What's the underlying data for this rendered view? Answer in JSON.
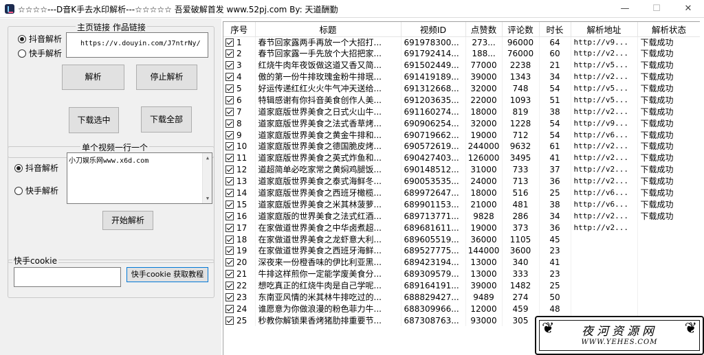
{
  "window": {
    "title": "☆☆☆☆---D音K手去水印解析---☆☆☆☆☆  吾爱破解首发   www.52pj.com   By:  天道酬勤",
    "min_glyph": "—",
    "max_glyph": "☐",
    "close_glyph": "✕"
  },
  "link_group": {
    "title": "主页链接  作品链接",
    "radio_douyin": "抖音解析",
    "radio_kuaishou": "快手解析",
    "url_value": "https://v.douyin.com/J7ntrNy/",
    "btn_parse": "解析",
    "btn_stop": "停止解析",
    "btn_download_selected": "下载选中",
    "btn_download_all": "下载全部"
  },
  "single_group": {
    "title": "单个视频一行一个",
    "radio_douyin": "抖音解析",
    "radio_kuaishou": "快手解析",
    "textarea_value": "小刀娱乐网www.x6d.com",
    "btn_start": "开始解析"
  },
  "cookie_group": {
    "title": "快手cookie",
    "input_value": "",
    "btn_tutorial": "快手cookie 获取教程"
  },
  "table": {
    "columns": [
      "序号",
      "标题",
      "视频ID",
      "点赞数",
      "评论数",
      "时长",
      "解析地址",
      "解析状态"
    ],
    "rows": [
      {
        "idx": "1",
        "title": "春节回家露两手再放一个大招打...",
        "vid": "691978300...",
        "likes": "273...",
        "comments": "96000",
        "dur": "64",
        "url": "http://v9...",
        "status": "下载成功"
      },
      {
        "idx": "2",
        "title": "春节回家露一手先放个大招把家...",
        "vid": "691792414...",
        "likes": "188...",
        "comments": "76000",
        "dur": "60",
        "url": "http://v2...",
        "status": "下载成功"
      },
      {
        "idx": "3",
        "title": "红烧牛肉年夜饭做这道又香又简...",
        "vid": "691502449...",
        "likes": "77000",
        "comments": "2238",
        "dur": "21",
        "url": "http://v5...",
        "status": "下载成功"
      },
      {
        "idx": "4",
        "title": "傲的第一份牛排玫瑰金粉牛排珉...",
        "vid": "691419189...",
        "likes": "39000",
        "comments": "1343",
        "dur": "34",
        "url": "http://v2...",
        "status": "下载成功"
      },
      {
        "idx": "5",
        "title": "好运传递红红火火牛气冲天送给...",
        "vid": "691312668...",
        "likes": "32000",
        "comments": "748",
        "dur": "54",
        "url": "http://v5...",
        "status": "下载成功"
      },
      {
        "idx": "6",
        "title": "特辑感谢有你抖音美食创作人美...",
        "vid": "691203635...",
        "likes": "22000",
        "comments": "1093",
        "dur": "51",
        "url": "http://v5...",
        "status": "下载成功"
      },
      {
        "idx": "7",
        "title": "道家庭版世界美食之日式火山牛...",
        "vid": "691160274...",
        "likes": "18000",
        "comments": "819",
        "dur": "38",
        "url": "http://v2...",
        "status": "下载成功"
      },
      {
        "idx": "8",
        "title": "道家庭版世界美食之法式香草烤...",
        "vid": "690906254...",
        "likes": "32000",
        "comments": "1228",
        "dur": "54",
        "url": "http://v9...",
        "status": "下载成功"
      },
      {
        "idx": "9",
        "title": "道家庭版世界美食之黄金牛排和...",
        "vid": "690719662...",
        "likes": "19000",
        "comments": "712",
        "dur": "54",
        "url": "http://v6...",
        "status": "下载成功"
      },
      {
        "idx": "10",
        "title": "道家庭版世界美食之德国脆皮烤...",
        "vid": "690572619...",
        "likes": "244000",
        "comments": "9632",
        "dur": "61",
        "url": "http://v2...",
        "status": "下载成功"
      },
      {
        "idx": "11",
        "title": "道家庭版世界美食之英式炸鱼和...",
        "vid": "690427403...",
        "likes": "126000",
        "comments": "3495",
        "dur": "41",
        "url": "http://v2...",
        "status": "下载成功"
      },
      {
        "idx": "12",
        "title": "道超简单必吃家常之黄焖鸡腿饭...",
        "vid": "690148512...",
        "likes": "31000",
        "comments": "733",
        "dur": "37",
        "url": "http://v2...",
        "status": "下载成功"
      },
      {
        "idx": "13",
        "title": "道家庭版世界美食之泰式海鲜冬...",
        "vid": "690053535...",
        "likes": "24000",
        "comments": "713",
        "dur": "36",
        "url": "http://v2...",
        "status": "下载成功"
      },
      {
        "idx": "14",
        "title": "道家庭版世界美食之西班牙橄榄...",
        "vid": "689972647...",
        "likes": "18000",
        "comments": "516",
        "dur": "25",
        "url": "http://v6...",
        "status": "下载成功"
      },
      {
        "idx": "15",
        "title": "道家庭版世界美食之米其林菠萝...",
        "vid": "689901153...",
        "likes": "21000",
        "comments": "481",
        "dur": "38",
        "url": "http://v6...",
        "status": "下载成功"
      },
      {
        "idx": "16",
        "title": "道家庭版的世界美食之法式红酒...",
        "vid": "689713771...",
        "likes": "9828",
        "comments": "286",
        "dur": "34",
        "url": "http://v2...",
        "status": "下载成功"
      },
      {
        "idx": "17",
        "title": "在家做道世界美食之中华卤煮超...",
        "vid": "689681611...",
        "likes": "19000",
        "comments": "373",
        "dur": "36",
        "url": "http://v2...",
        "status": ""
      },
      {
        "idx": "18",
        "title": "在家做道世界美食之龙虾意大利...",
        "vid": "689605519...",
        "likes": "36000",
        "comments": "1105",
        "dur": "45",
        "url": "",
        "status": ""
      },
      {
        "idx": "19",
        "title": "在家做道世界美食之西班牙海鲜...",
        "vid": "689527775...",
        "likes": "144000",
        "comments": "3600",
        "dur": "23",
        "url": "",
        "status": ""
      },
      {
        "idx": "20",
        "title": "深夜来一份橙香味的伊比利亚黑...",
        "vid": "689423194...",
        "likes": "13000",
        "comments": "340",
        "dur": "41",
        "url": "",
        "status": ""
      },
      {
        "idx": "21",
        "title": "牛排这样煎你一定能学废美食分...",
        "vid": "689309579...",
        "likes": "13000",
        "comments": "333",
        "dur": "23",
        "url": "",
        "status": ""
      },
      {
        "idx": "22",
        "title": "想吃真正的红烧牛肉是自己学呢...",
        "vid": "689164191...",
        "likes": "39000",
        "comments": "1482",
        "dur": "25",
        "url": "",
        "status": ""
      },
      {
        "idx": "23",
        "title": "东南亚风情的米其林牛排吃过的...",
        "vid": "688829427...",
        "likes": "9489",
        "comments": "274",
        "dur": "50",
        "url": "",
        "status": ""
      },
      {
        "idx": "24",
        "title": "谁愿意为你做浪漫的粉色菲力牛...",
        "vid": "688309966...",
        "likes": "12000",
        "comments": "459",
        "dur": "48",
        "url": "",
        "status": ""
      },
      {
        "idx": "25",
        "title": "秒教你解锁果香烤猪肋排重要节...",
        "vid": "687308763...",
        "likes": "93000",
        "comments": "305",
        "dur": "",
        "url": "",
        "status": ""
      }
    ]
  },
  "watermark": {
    "title": "夜河资源网",
    "url": "WWW.YEHES.COM"
  }
}
